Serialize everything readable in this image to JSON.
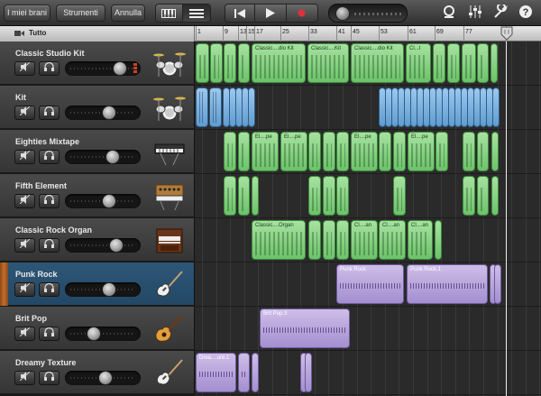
{
  "toolbar": {
    "my_songs": "I miei brani",
    "instruments": "Strumenti",
    "undo": "Annulla",
    "view_keyboard_icon": "keyboard-icon",
    "view_tracks_icon": "tracks-list-icon",
    "rewind_icon": "skip-back-icon",
    "play_icon": "play-icon",
    "record_icon": "record-icon",
    "record_color": "#e0303a"
  },
  "ruler": {
    "all_label": "Tutto",
    "ticks": [
      "1",
      "9",
      "13",
      "15",
      "17",
      "25",
      "33",
      "41",
      "45",
      "53",
      "61",
      "69",
      "77",
      "8"
    ]
  },
  "tracks": [
    {
      "name": "Classic Studio Kit",
      "instrument": "drum-kit-icon",
      "volume": 0.78,
      "selected": false,
      "meter": true
    },
    {
      "name": "Kit",
      "instrument": "drum-kit-icon",
      "volume": 0.6,
      "selected": false,
      "meter": false
    },
    {
      "name": "Eighties Mixtape",
      "instrument": "synth-keyboard-icon",
      "volume": 0.66,
      "selected": false,
      "meter": false
    },
    {
      "name": "Fifth Element",
      "instrument": "analog-synth-icon",
      "volume": 0.6,
      "selected": false,
      "meter": false
    },
    {
      "name": "Classic Rock Organ",
      "instrument": "organ-icon",
      "volume": 0.72,
      "selected": false,
      "meter": false
    },
    {
      "name": "Punk Rock",
      "instrument": "electric-guitar-icon",
      "volume": 0.6,
      "selected": true,
      "meter": false
    },
    {
      "name": "Brit Pop",
      "instrument": "acoustic-guitar-icon",
      "volume": 0.35,
      "selected": false,
      "meter": false
    },
    {
      "name": "Dreamy Texture",
      "instrument": "electric-guitar-icon",
      "volume": 0.55,
      "selected": false,
      "meter": false
    }
  ],
  "regions": {
    "classic_studio_kit": [
      "Classic....dio Kit",
      "Classic....Kit",
      "Classic....dio Kit",
      "Cl...t"
    ],
    "eighties": [
      "El....pe",
      "El....pe",
      "El....pe",
      "El....pe"
    ],
    "organ": [
      "Classic....Organ",
      "Cl....an",
      "Cl....an",
      "Cl....an"
    ],
    "punk": [
      "Punk Rock",
      "Punk Rock.1"
    ],
    "brit": [
      "Brit Pop.3"
    ],
    "dreamy": [
      "Drea....ure.1"
    ]
  }
}
